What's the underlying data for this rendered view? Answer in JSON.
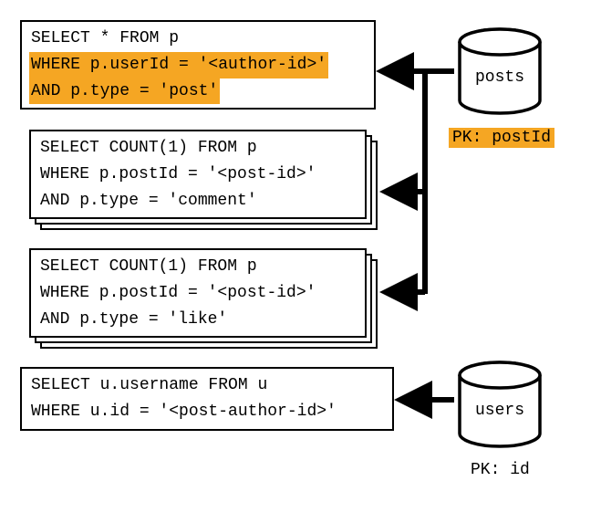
{
  "queries": {
    "q1": {
      "line1": "SELECT * FROM p",
      "line2": "WHERE p.userId = '<author-id>'",
      "line3": "AND p.type = 'post'"
    },
    "q2": {
      "line1": "SELECT COUNT(1) FROM p",
      "line2": "WHERE p.postId = '<post-id>'",
      "line3": "AND p.type = 'comment'"
    },
    "q3": {
      "line1": "SELECT COUNT(1) FROM p",
      "line2": "WHERE p.postId = '<post-id>'",
      "line3": "AND p.type = 'like'"
    },
    "q4": {
      "line1": "SELECT u.username FROM u",
      "line2": "WHERE u.id = '<post-author-id>'"
    }
  },
  "databases": {
    "posts": {
      "label": "posts",
      "pk": "PK: postId"
    },
    "users": {
      "label": "users",
      "pk": "PK: id"
    }
  }
}
